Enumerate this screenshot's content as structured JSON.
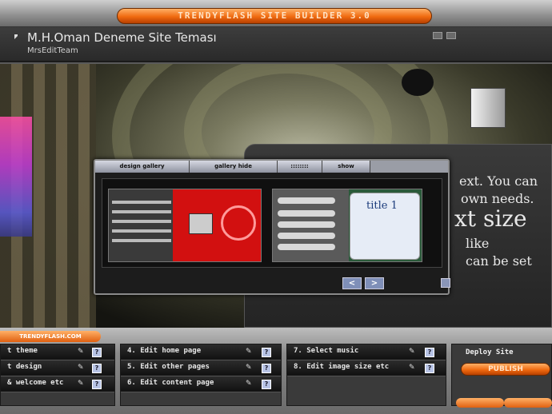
{
  "top_bar": {
    "title": "TRENDYFLASH SITE BUILDER 3.0"
  },
  "header": {
    "site_title": "M.H.Oman Deneme Site Teması",
    "site_subtitle": "MrsEditTeam"
  },
  "hero_text": {
    "line1": "ext. You can",
    "line2": "own needs.",
    "line3": "xt size",
    "line4": "like",
    "line5": "can be set"
  },
  "gallery": {
    "tabs": [
      "design gallery",
      "gallery hide",
      "::::::::",
      "show"
    ],
    "thumb2_title": "title 1",
    "prev_label": "<",
    "next_label": ">"
  },
  "footer": {
    "logo": "TRENDYFLASH.COM",
    "columns": [
      {
        "items": [
          "t theme",
          "t design",
          "& welcome etc"
        ]
      },
      {
        "items": [
          "4.  Edit home page",
          "5.  Edit other pages",
          "6.  Edit content page"
        ]
      },
      {
        "items": [
          "7.  Select music",
          "8.  Edit image size etc"
        ]
      }
    ],
    "deploy_label": "Deploy Site",
    "publish_label": "PUBLISH",
    "help_glyph": "?",
    "wand_glyph": "✎"
  },
  "colors": {
    "accent": "#f06a10",
    "panel": "#2a2a2a",
    "button_blue": "#b8c4e6"
  }
}
